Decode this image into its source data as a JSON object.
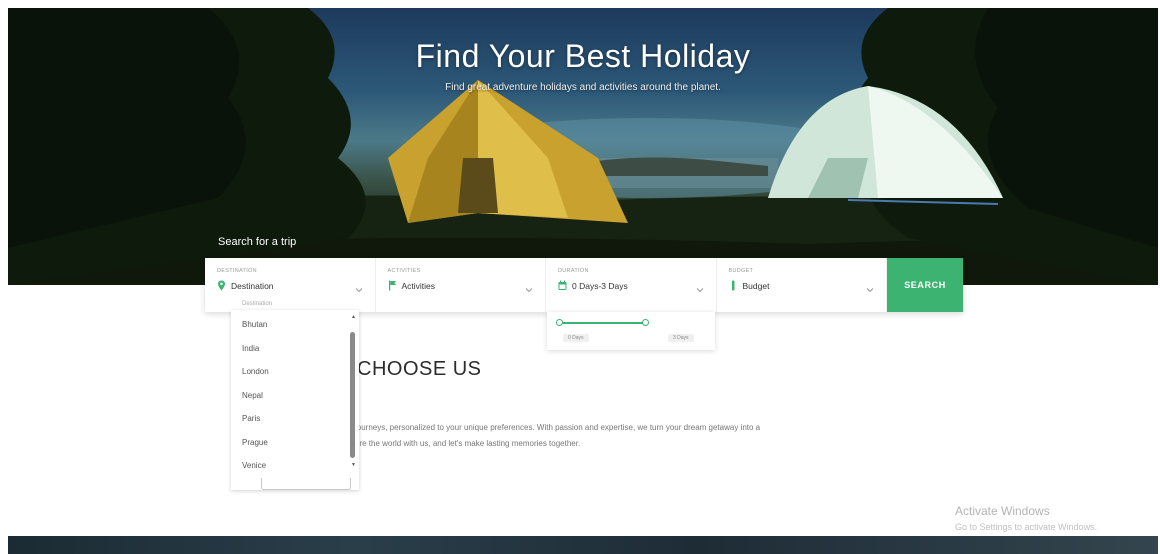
{
  "hero": {
    "title": "Find Your Best Holiday",
    "subtitle": "Find great adventure holidays and activities around the planet."
  },
  "search": {
    "label": "Search for a trip",
    "fields": [
      {
        "caption": "Destination",
        "value": "Destination",
        "icon": "map-pin-icon"
      },
      {
        "caption": "Activities",
        "value": "Activities",
        "icon": "flag-icon"
      },
      {
        "caption": "Duration",
        "value": "0 Days-3 Days",
        "icon": "calendar-icon"
      },
      {
        "caption": "Budget",
        "value": "Budget",
        "icon": "money-icon"
      }
    ],
    "button_label": "SEARCH"
  },
  "destination_dropdown": {
    "options": [
      "Destination",
      "Bhutan",
      "India",
      "London",
      "Nepal",
      "Paris",
      "Prague",
      "Venice"
    ]
  },
  "duration_slider": {
    "min_label": "0 Days",
    "max_label": "3 Days"
  },
  "why": {
    "title": "CHOOSE US",
    "text_line1": "journeys, personalized to your unique preferences. With passion and expertise, we turn your dream getaway into a",
    "text_line2": "ore the world with us, and let's make lasting memories together."
  },
  "watermark": {
    "line1": "Activate Windows",
    "line2": "Go to Settings to activate Windows."
  },
  "colors": {
    "accent": "#3cb371"
  }
}
